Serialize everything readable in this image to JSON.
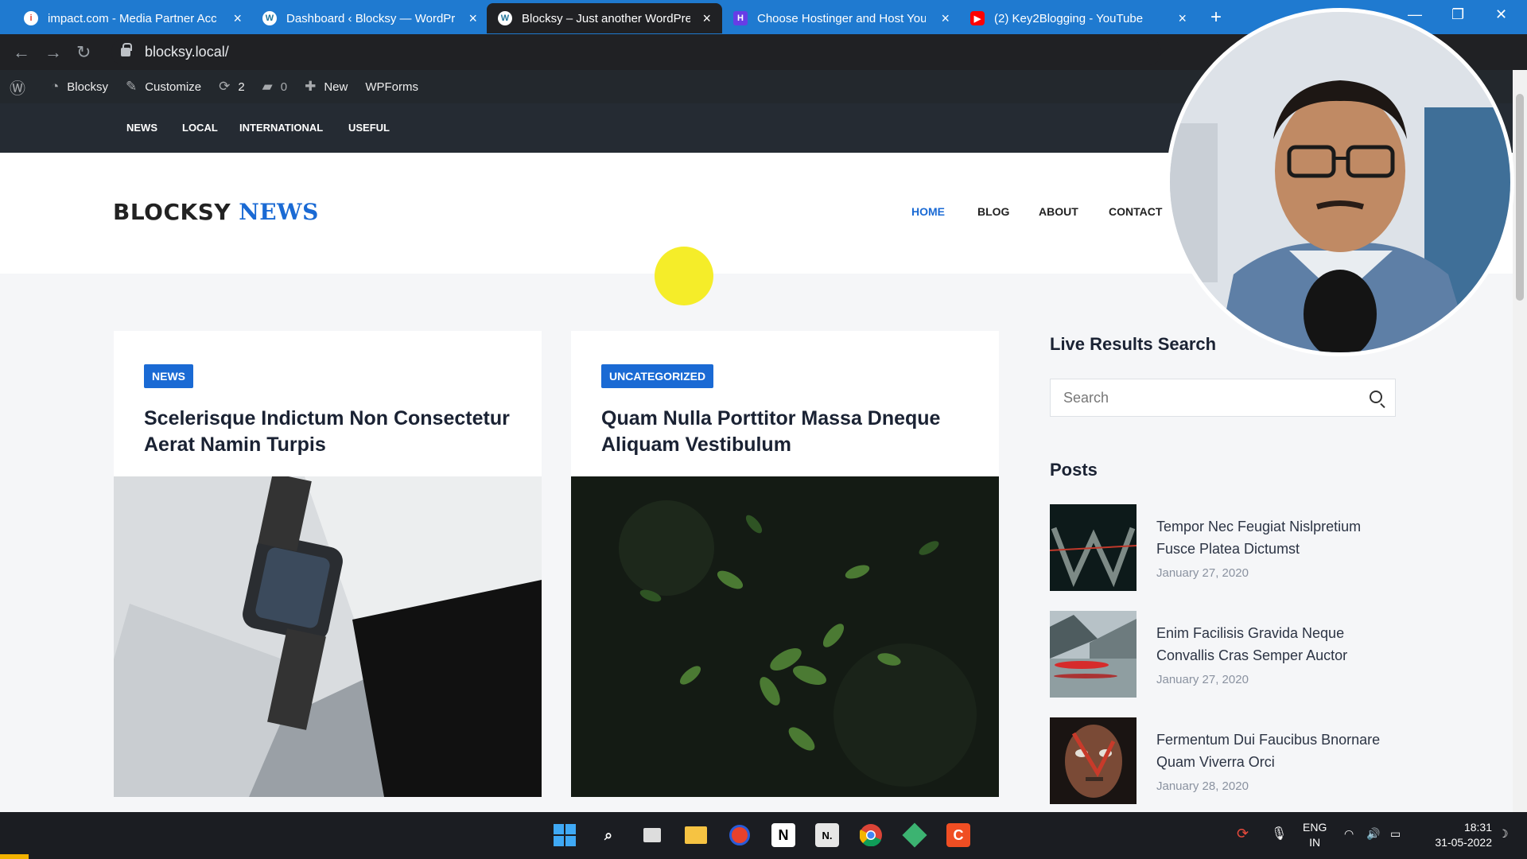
{
  "browser": {
    "tabs": [
      {
        "title": "impact.com - Media Partner Acc",
        "icon": "impact-icon",
        "active": false
      },
      {
        "title": "Dashboard ‹ Blocksy — WordPre",
        "icon": "wordpress-icon",
        "active": false
      },
      {
        "title": "Blocksy – Just another WordPress",
        "icon": "wordpress-icon",
        "active": true
      },
      {
        "title": "Choose Hostinger and Host Your",
        "icon": "hostinger-icon",
        "active": false
      },
      {
        "title": "(2) Key2Blogging - YouTube",
        "icon": "youtube-icon",
        "active": false
      }
    ],
    "close_glyph": "×",
    "new_tab_glyph": "+",
    "url": "blocksy.local/"
  },
  "adminbar": {
    "site_name": "Blocksy",
    "customize": "Customize",
    "updates_count": "2",
    "comments_count": "0",
    "new_label": "New",
    "wpforms": "WPForms"
  },
  "topmenu": [
    "NEWS",
    "LOCAL",
    "INTERNATIONAL",
    "USEFUL"
  ],
  "header": {
    "logo_part1": "BLOCKSY",
    "logo_part2": "NEWS",
    "nav": [
      {
        "label": "HOME",
        "current": true
      },
      {
        "label": "BLOG",
        "current": false
      },
      {
        "label": "ABOUT",
        "current": false
      },
      {
        "label": "CONTACT",
        "current": false
      }
    ]
  },
  "cards": [
    {
      "category": "NEWS",
      "title": "Scelerisque Indictum Non Consectetur Aerat Namin Turpis",
      "image": "smartwatch-and-phone-photo"
    },
    {
      "category": "UNCATEGORIZED",
      "title": "Quam Nulla Porttitor Massa Dneque Aliquam Vestibulum",
      "image": "green-leaves-photo"
    }
  ],
  "sidebar": {
    "search_title": "Live Results Search",
    "search_placeholder": "Search",
    "posts_title": "Posts",
    "posts": [
      {
        "title": "Tempor Nec Feugiat Nislpretium Fusce Platea Dictumst",
        "date": "January 27, 2020",
        "thumb": "abstract-dark-thumb"
      },
      {
        "title": "Enim Facilisis Gravida Neque Convallis Cras Semper Auctor",
        "date": "January 27, 2020",
        "thumb": "lake-boat-thumb"
      },
      {
        "title": "Fermentum Dui Faucibus Bnornare Quam Viverra Orci",
        "date": "January 28, 2020",
        "thumb": "painted-face-thumb"
      }
    ]
  },
  "taskbar": {
    "lang_line1": "ENG",
    "lang_line2": "IN",
    "time": "18:31",
    "date": "31-05-2022"
  },
  "colors": {
    "accent": "#1a6ad4",
    "tabstrip": "#1f7ad0",
    "adminbar": "#23282d",
    "topmenu": "#252b33"
  }
}
